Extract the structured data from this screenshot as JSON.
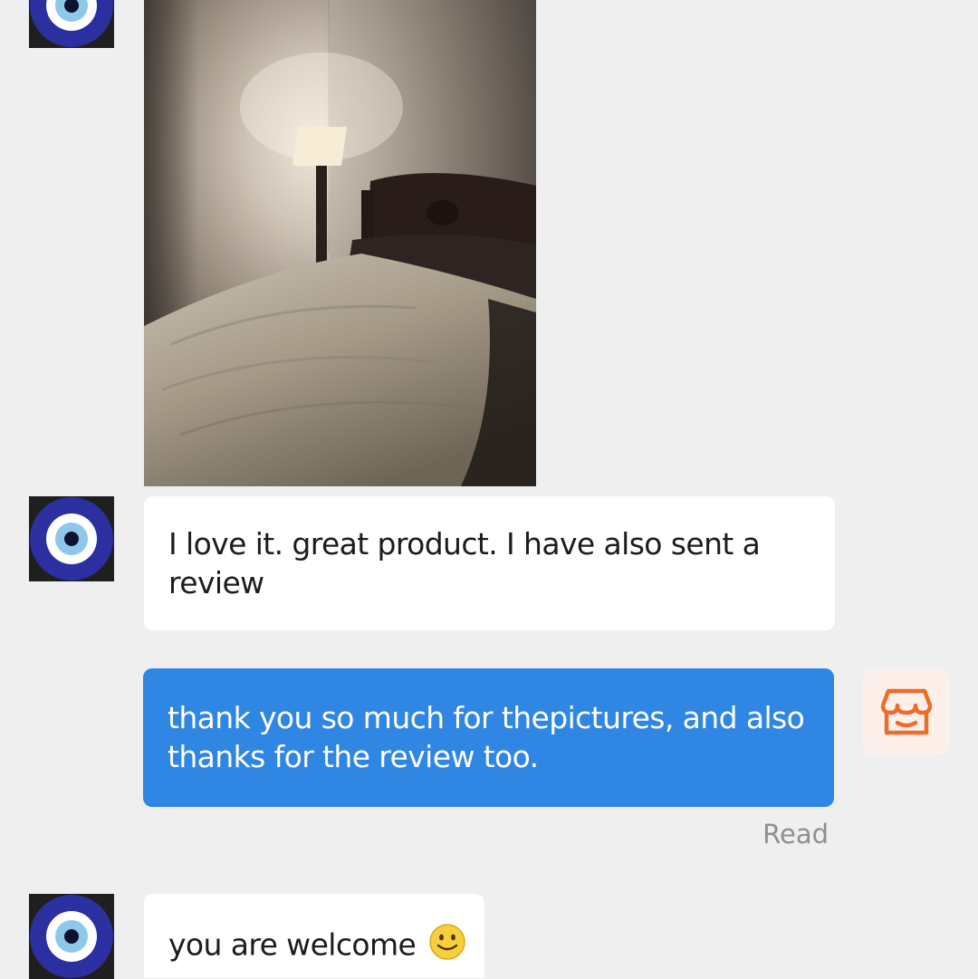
{
  "chat": {
    "messages": [
      {
        "id": "m1",
        "direction": "incoming",
        "type": "image",
        "image_description_icon": "photo-bedroom-lamp"
      },
      {
        "id": "m2",
        "direction": "incoming",
        "type": "text",
        "text": "I love it. great product. I have also sent a review"
      },
      {
        "id": "m3",
        "direction": "outgoing",
        "type": "text",
        "text": "thank you so much for thepictures, and also thanks for the review too.",
        "status": "Read"
      },
      {
        "id": "m4",
        "direction": "incoming",
        "type": "text",
        "text": "you are welcome",
        "emoji": "slightly-smiling-face-icon"
      }
    ]
  },
  "avatars": {
    "customer": {
      "icon": "evil-eye-avatar-icon"
    },
    "seller": {
      "icon": "store-icon"
    }
  },
  "colors": {
    "background": "#efefef",
    "incoming_bubble": "#ffffff",
    "outgoing_bubble": "#2f86e3",
    "read_status": "#8f8f8f",
    "store_icon": "#ee6b2a",
    "store_icon_bg": "#fdf0ea",
    "avatar_blue": "#2b2fa0"
  }
}
